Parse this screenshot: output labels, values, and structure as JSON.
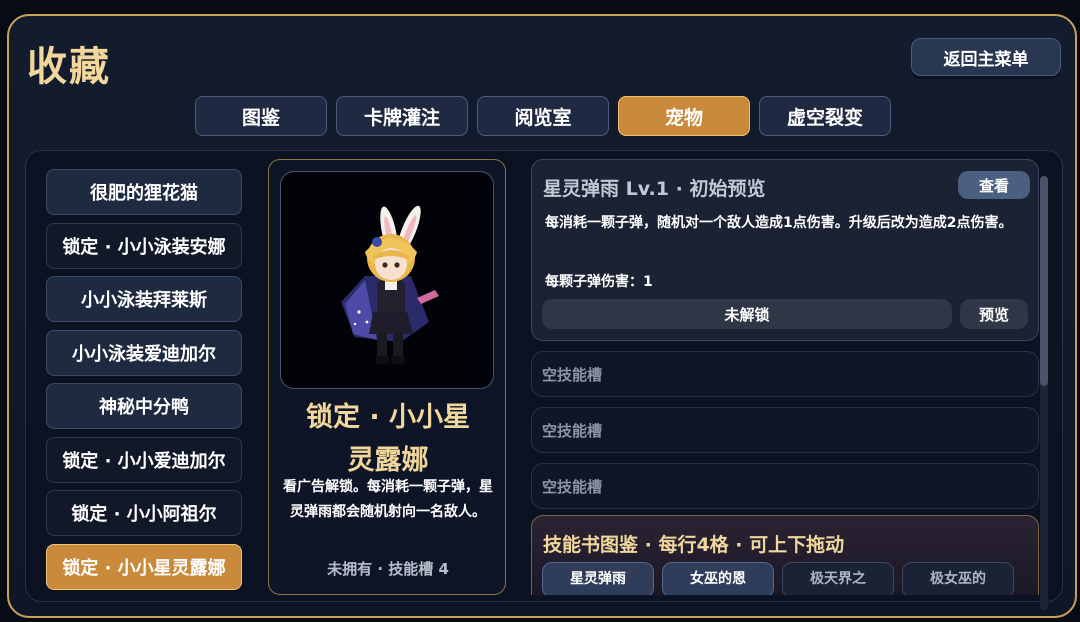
{
  "title": "收藏",
  "back_label": "返回主菜单",
  "tabs": [
    "图鉴",
    "卡牌灌注",
    "阅览室",
    "宠物",
    "虚空裂变"
  ],
  "active_tab": "宠物",
  "pets": [
    {
      "label": "很肥的狸花猫",
      "state": "owned"
    },
    {
      "label": "锁定 · 小小泳装安娜",
      "state": "locked"
    },
    {
      "label": "小小泳装拜莱斯",
      "state": "owned"
    },
    {
      "label": "小小泳装爱迪加尔",
      "state": "owned"
    },
    {
      "label": "神秘中分鸭",
      "state": "owned"
    },
    {
      "label": "锁定 · 小小爱迪加尔",
      "state": "locked"
    },
    {
      "label": "锁定 · 小小阿祖尔",
      "state": "locked"
    },
    {
      "label": "锁定 · 小小星灵露娜",
      "state": "selected"
    }
  ],
  "detail": {
    "name_line1": "锁定 · 小小星",
    "name_line2": "灵露娜",
    "description": "看广告解锁。每消耗一颗子弹，星灵弹雨都会随机射向一名敌人。",
    "status": "未拥有 · 技能槽 4"
  },
  "skill": {
    "title": "星灵弹雨 Lv.1 · 初始预览",
    "view_label": "查看",
    "description": "每消耗一颗子弹，随机对一个敌人造成1点伤害。升级后改为造成2点伤害。",
    "damage": "每颗子弹伤害：1",
    "unlock_label": "未解锁",
    "preview_label": "预览"
  },
  "empty_slots": [
    "空技能槽",
    "空技能槽",
    "空技能槽"
  ],
  "skill_book": {
    "title": "技能书图鉴 · 每行4格 · 可上下拖动",
    "items": [
      {
        "label": "星灵弹雨",
        "active": true
      },
      {
        "label": "女巫的恩",
        "active": true
      },
      {
        "label": "极天界之",
        "active": false
      },
      {
        "label": "极女巫的",
        "active": false
      }
    ]
  },
  "colors": {
    "accent_gold": "#c98a3c",
    "title_gold": "#f1d79c",
    "panel_bg": "#0b1221"
  }
}
